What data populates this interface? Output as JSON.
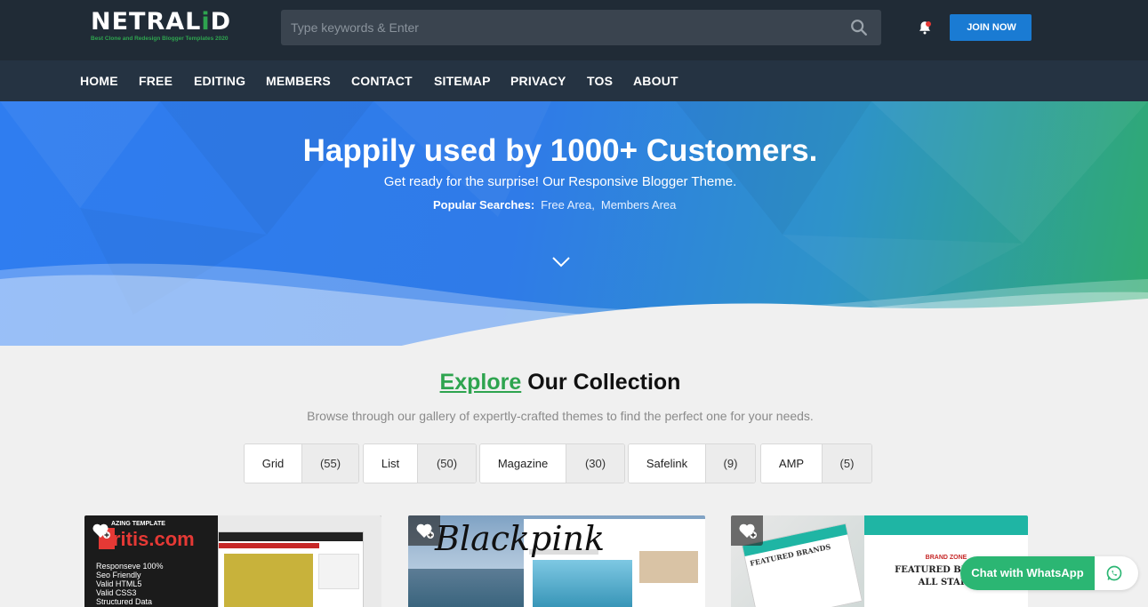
{
  "header": {
    "logo_main": "NETRAL",
    "logo_accent": "i",
    "logo_end": "D",
    "logo_tagline": "Best Clone and Redesign Blogger Templates 2020",
    "search_placeholder": "Type keywords & Enter",
    "join_label": "JOIN NOW"
  },
  "nav": {
    "items": [
      {
        "label": "HOME"
      },
      {
        "label": "FREE"
      },
      {
        "label": "EDITING"
      },
      {
        "label": "MEMBERS"
      },
      {
        "label": "CONTACT"
      },
      {
        "label": "SITEMAP"
      },
      {
        "label": "PRIVACY"
      },
      {
        "label": "TOS"
      },
      {
        "label": "ABOUT"
      }
    ]
  },
  "hero": {
    "title": "Happily used by 1000+ Customers.",
    "subtitle": "Get ready for the surprise! Our Responsive Blogger Theme.",
    "popular_label": "Popular Searches:",
    "popular_links": [
      "Free Area,",
      "Members Area"
    ]
  },
  "collection": {
    "title_highlight": "Explore",
    "title_rest": "Our Collection",
    "description": "Browse through our gallery of expertly-crafted themes to find the perfect one for your needs.",
    "filters": [
      {
        "name": "Grid",
        "count": "(55)"
      },
      {
        "name": "List",
        "count": "(50)"
      },
      {
        "name": "Magazine",
        "count": "(30)"
      },
      {
        "name": "Safelink",
        "count": "(9)"
      },
      {
        "name": "AMP",
        "count": "(5)"
      }
    ]
  },
  "cards": [
    {
      "top_label": "AZING TEMPLATE",
      "brand": "ritis.com",
      "features": [
        "Responseve 100%",
        "Seo Friendly",
        "Valid HTML5",
        "Valid CSS3",
        "Structured Data"
      ]
    },
    {
      "script_title": "Blackpink"
    },
    {
      "brand_zone": "BRAND ZONE",
      "featured": "FEATURED BRANDS",
      "stars": "ALL STARS"
    }
  ],
  "whatsapp": {
    "label": "Chat with WhatsApp"
  },
  "colors": {
    "header_bg": "#202b36",
    "nav_bg": "#253342",
    "accent_green": "#2ea44f",
    "join_blue": "#1a7bd3",
    "whatsapp_green": "#2bb673"
  }
}
